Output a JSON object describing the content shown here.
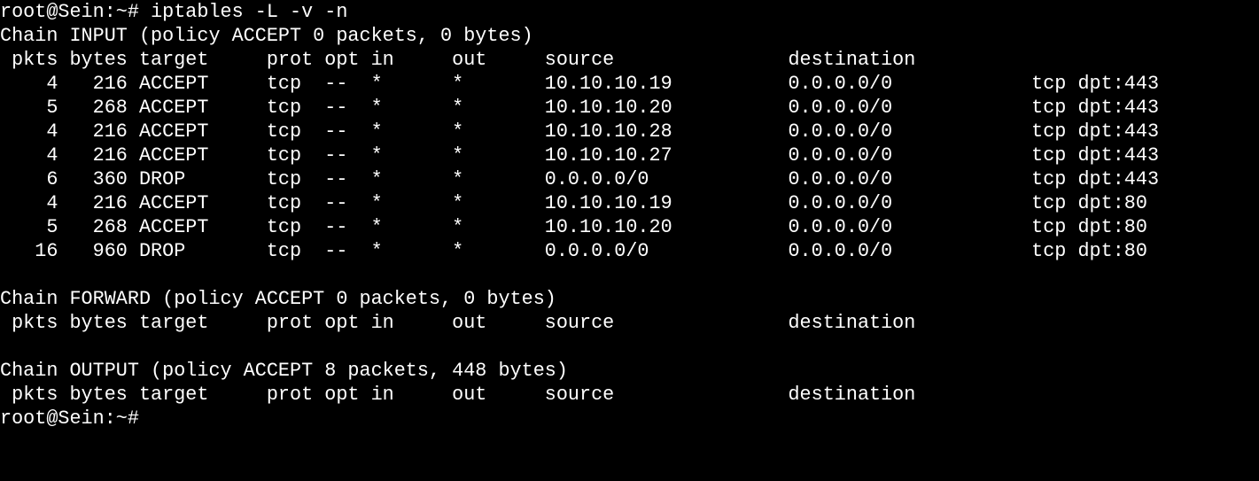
{
  "prompt": "root@Sein:~#",
  "command": "iptables -L -v -n",
  "chains": [
    {
      "title": "Chain INPUT (policy ACCEPT 0 packets, 0 bytes)",
      "header": " pkts bytes target     prot opt in     out     source               destination",
      "rows": [
        "    4   216 ACCEPT     tcp  --  *      *       10.10.10.19          0.0.0.0/0            tcp dpt:443",
        "    5   268 ACCEPT     tcp  --  *      *       10.10.10.20          0.0.0.0/0            tcp dpt:443",
        "    4   216 ACCEPT     tcp  --  *      *       10.10.10.28          0.0.0.0/0            tcp dpt:443",
        "    4   216 ACCEPT     tcp  --  *      *       10.10.10.27          0.0.0.0/0            tcp dpt:443",
        "    6   360 DROP       tcp  --  *      *       0.0.0.0/0            0.0.0.0/0            tcp dpt:443",
        "    4   216 ACCEPT     tcp  --  *      *       10.10.10.19          0.0.0.0/0            tcp dpt:80",
        "    5   268 ACCEPT     tcp  --  *      *       10.10.10.20          0.0.0.0/0            tcp dpt:80",
        "   16   960 DROP       tcp  --  *      *       0.0.0.0/0            0.0.0.0/0            tcp dpt:80"
      ]
    },
    {
      "title": "Chain FORWARD (policy ACCEPT 0 packets, 0 bytes)",
      "header": " pkts bytes target     prot opt in     out     source               destination",
      "rows": []
    },
    {
      "title": "Chain OUTPUT (policy ACCEPT 8 packets, 448 bytes)",
      "header": " pkts bytes target     prot opt in     out     source               destination",
      "rows": []
    }
  ],
  "colors": {
    "background": "#000000",
    "foreground": "#ffffff"
  }
}
